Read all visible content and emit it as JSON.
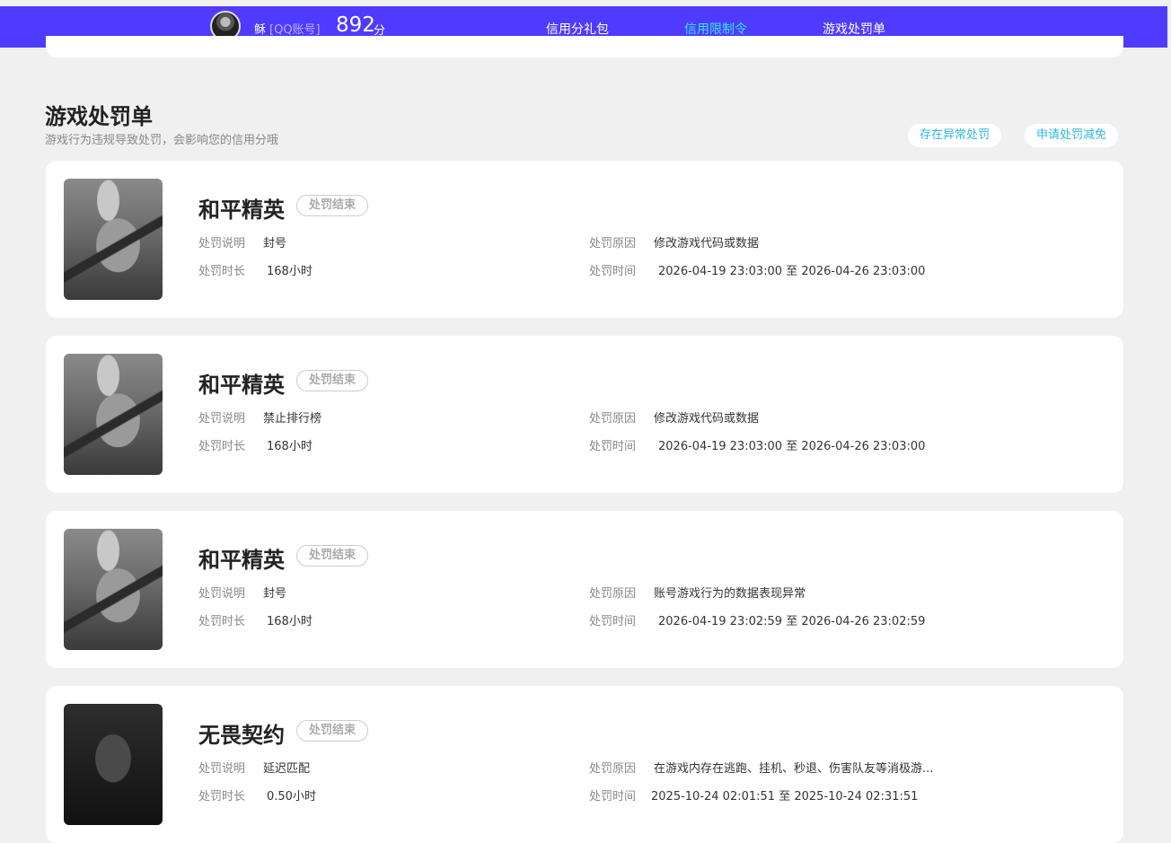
{
  "header": {
    "username": "稣",
    "account_type": "[QQ账号]",
    "score": "892",
    "score_unit": "分",
    "nav": [
      {
        "label": "信用分礼包",
        "active": false
      },
      {
        "label": "信用限制令",
        "active": true
      },
      {
        "label": "游戏处罚单",
        "active": false
      }
    ],
    "accent_color": "#4f3bff",
    "active_color": "#35e6f0"
  },
  "section": {
    "title": "游戏处罚单",
    "subtitle": "游戏行为违规导致处罚，会影响您的信用分哦",
    "actions": [
      "存在异常处罚",
      "申请处罚减免"
    ]
  },
  "labels": {
    "desc": "处罚说明",
    "duration": "处罚时长",
    "reason": "处罚原因",
    "time": "处罚时间"
  },
  "penalties": [
    {
      "game": "和平精英",
      "status": "处罚结束",
      "desc": "封号",
      "duration": "168小时",
      "reason": "修改游戏代码或数据",
      "time": "2026-04-19 23:03:00 至 2026-04-26 23:03:00",
      "thumb_icon": "peacekeeper-elite-cover"
    },
    {
      "game": "和平精英",
      "status": "处罚结束",
      "desc": "禁止排行榜",
      "duration": "168小时",
      "reason": "修改游戏代码或数据",
      "time": "2026-04-19 23:03:00 至 2026-04-26 23:03:00",
      "thumb_icon": "peacekeeper-elite-cover"
    },
    {
      "game": "和平精英",
      "status": "处罚结束",
      "desc": "封号",
      "duration": "168小时",
      "reason": "账号游戏行为的数据表现异常",
      "time": "2026-04-19 23:02:59 至 2026-04-26 23:02:59",
      "thumb_icon": "peacekeeper-elite-cover"
    },
    {
      "game": "无畏契约",
      "status": "处罚结束",
      "desc": "延迟匹配",
      "duration": "0.50小时",
      "reason": "在游戏内存在逃跑、挂机、秒退、伤害队友等消极游...",
      "time": "2025-10-24 02:01:51 至 2025-10-24 02:31:51",
      "thumb_icon": "valorant-cover"
    }
  ]
}
